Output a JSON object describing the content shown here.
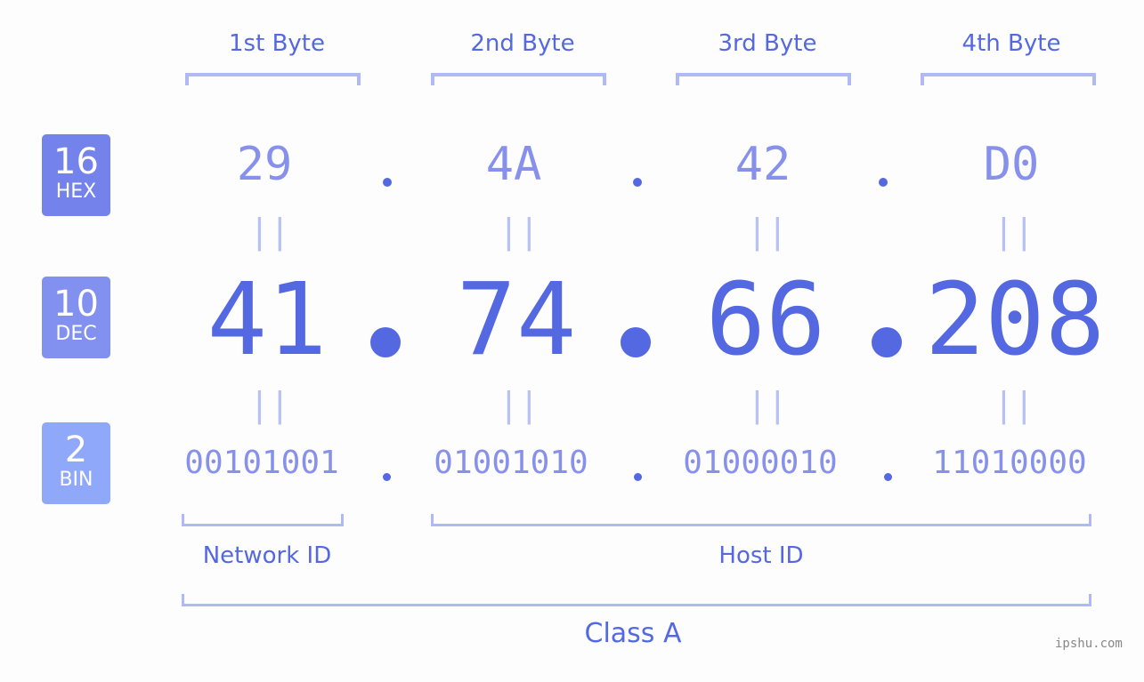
{
  "badges": [
    {
      "num": "16",
      "label": "HEX",
      "color": "#7483ec"
    },
    {
      "num": "10",
      "label": "DEC",
      "color": "#8290f0"
    },
    {
      "num": "2",
      "label": "BIN",
      "color": "#90a8f9"
    }
  ],
  "bytes": [
    {
      "header": "1st Byte",
      "hex": "29",
      "dec": "41",
      "bin": "00101001"
    },
    {
      "header": "2nd Byte",
      "hex": "4A",
      "dec": "74",
      "bin": "01001010"
    },
    {
      "header": "3rd Byte",
      "hex": "42",
      "dec": "66",
      "bin": "01000010"
    },
    {
      "header": "4th Byte",
      "hex": "D0",
      "dec": "208",
      "bin": "11010000"
    }
  ],
  "equals_symbol": "||",
  "segments": {
    "network_id": "Network ID",
    "host_id": "Host ID",
    "class": "Class A"
  },
  "watermark": "ipshu.com",
  "colors": {
    "accent": "#5468e2",
    "light": "#8791ec",
    "bracket": "#aeb9f6"
  }
}
